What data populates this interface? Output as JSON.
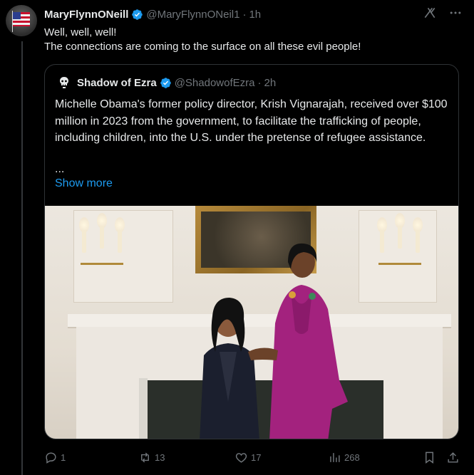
{
  "tweet": {
    "display_name": "MaryFlynnONeill",
    "handle": "@MaryFlynnONeil1",
    "separator": "·",
    "time": "1h",
    "text_line1": "Well, well, well!",
    "text_line2": "The connections are coming to the surface on all these evil people!"
  },
  "quote": {
    "display_name": "Shadow of Ezra",
    "handle": "@ShadowofEzra",
    "separator": "·",
    "time": "2h",
    "text": "Michelle Obama's former policy director, Krish Vignarajah, received over $100 million in 2023 from the government, to facilitate the trafficking of people, including children, into the U.S. under the pretense of refugee assistance.",
    "ellipsis": "...",
    "show_more": "Show more"
  },
  "actions": {
    "replies": "1",
    "reposts": "13",
    "likes": "17",
    "views": "268"
  },
  "icons": {
    "verified": "verified-badge-icon",
    "grok": "grok-icon",
    "more": "more-icon",
    "reply": "reply-icon",
    "repost": "repost-icon",
    "like": "like-icon",
    "views": "views-icon",
    "bookmark": "bookmark-icon",
    "share": "share-icon"
  },
  "colors": {
    "background": "#000000",
    "text": "#e7e9ea",
    "muted": "#71767b",
    "accent": "#1d9bf0",
    "border": "#2f3336"
  }
}
